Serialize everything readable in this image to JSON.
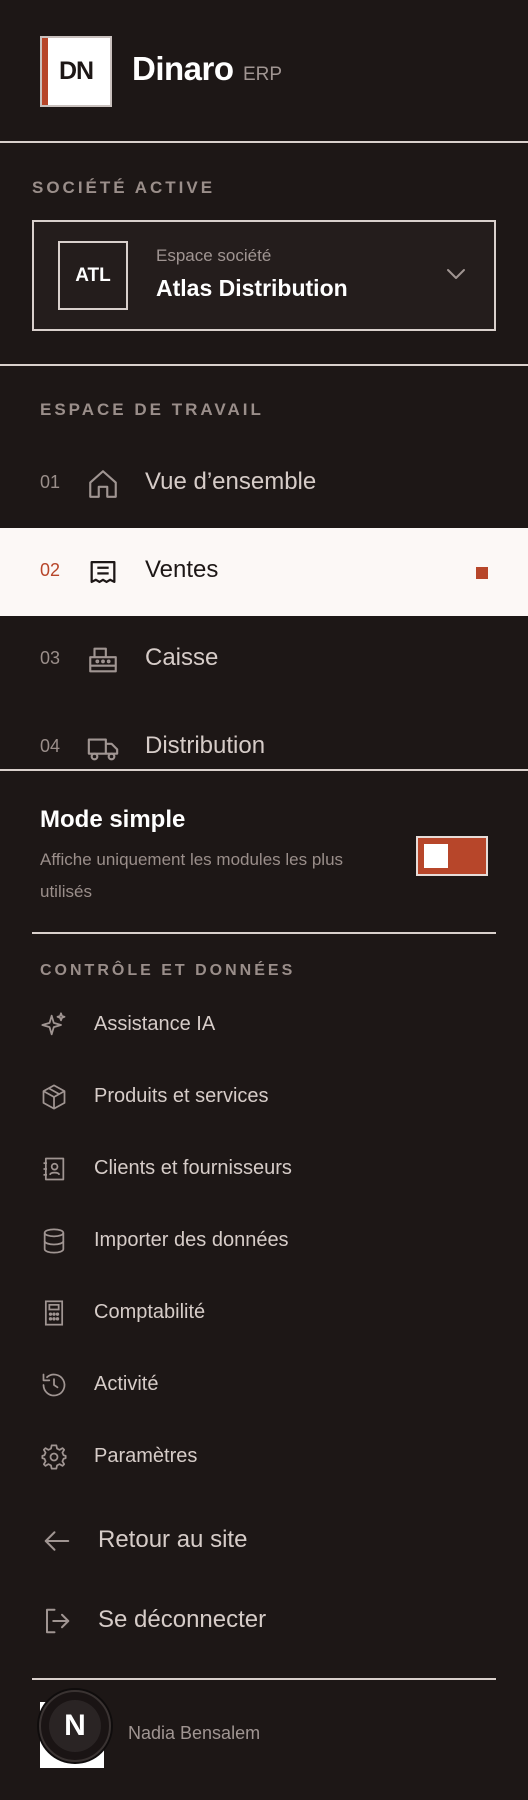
{
  "brand": {
    "logo_text": "DN",
    "name": "Dinaro",
    "suffix": "ERP"
  },
  "company": {
    "section_label": "SOCIÉTÉ ACTIVE",
    "badge": "ATL",
    "caption": "Espace société",
    "name": "Atlas Distribution",
    "chevron_icon": "chevron-down-icon"
  },
  "workspace": {
    "section_label": "ESPACE DE TRAVAIL",
    "items": [
      {
        "num": "01",
        "label": "Vue d’ensemble",
        "icon": "home-icon",
        "active": false
      },
      {
        "num": "02",
        "label": "Ventes",
        "icon": "receipt-icon",
        "active": true
      },
      {
        "num": "03",
        "label": "Caisse",
        "icon": "cash-register-icon",
        "active": false
      },
      {
        "num": "04",
        "label": "Distribution",
        "icon": "truck-icon",
        "active": false
      }
    ]
  },
  "mode": {
    "title": "Mode simple",
    "description": "Affiche uniquement les modules les plus utilisés",
    "enabled": true
  },
  "control": {
    "section_label": "CONTRÔLE ET DONNÉES",
    "items": [
      {
        "label": "Assistance IA",
        "icon": "sparkles-icon"
      },
      {
        "label": "Produits et services",
        "icon": "package-icon"
      },
      {
        "label": "Clients et fournisseurs",
        "icon": "contact-book-icon"
      },
      {
        "label": "Importer des données",
        "icon": "database-icon"
      },
      {
        "label": "Comptabilité",
        "icon": "calculator-icon"
      },
      {
        "label": "Activité",
        "icon": "history-icon"
      },
      {
        "label": "Paramètres",
        "icon": "gear-icon"
      }
    ]
  },
  "footer": {
    "back_label": "Retour au site",
    "logout_label": "Se déconnecter"
  },
  "user": {
    "initials": "N",
    "name": "Nadia Bensalem"
  },
  "colors": {
    "background": "#1d1716",
    "accent": "#b7462a",
    "active_bg": "#fcf8f6"
  }
}
